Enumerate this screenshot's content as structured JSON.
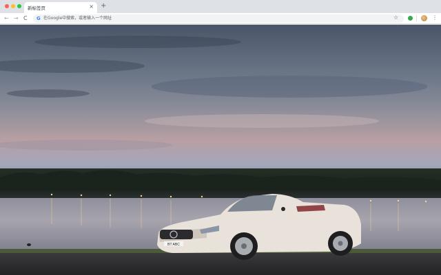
{
  "browser": {
    "tab": {
      "title": "新标签页",
      "close_glyph": "×"
    },
    "new_tab_glyph": "+",
    "toolbar": {
      "back_glyph": "←",
      "forward_glyph": "→",
      "reload_glyph": "C",
      "omnibox_placeholder": "在Google中搜索，或者输入一个网址",
      "google_glyph": "G",
      "bookmark_glyph": "☆",
      "menu_glyph": "⋮"
    }
  },
  "wallpaper": {
    "plate_text": "BT ABC",
    "colors": {
      "sky_top": "#4a5568",
      "sky_glow": "#b89fa3",
      "car": "#e8e2da",
      "water": "#a7a4ad"
    }
  }
}
